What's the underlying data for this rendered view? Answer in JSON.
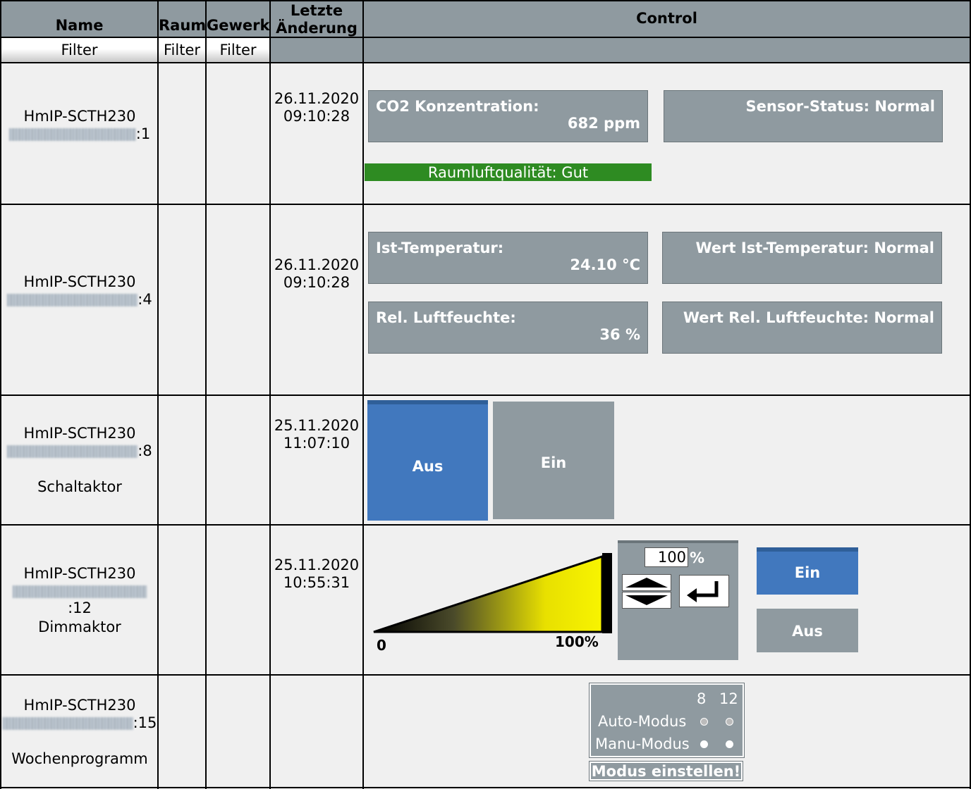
{
  "header": {
    "name": "Name",
    "raum": "Raum",
    "gewerk": "Gewerk",
    "letzte_line1": "Letzte",
    "letzte_line2": "Änderung",
    "control": "Control"
  },
  "filters": {
    "name": "Filter",
    "raum": "Filter",
    "gewerk": "Filter"
  },
  "rows": [
    {
      "device": "HmIP-SCTH230",
      "channel_suffix": ":1",
      "date": "26.11.2020",
      "time": "09:10:28",
      "co2_label": "CO2 Konzentration:",
      "co2_value": "682 ppm",
      "sensor_status": "Sensor-Status: Normal",
      "air_quality": "Raumluftqualität: Gut"
    },
    {
      "device": "HmIP-SCTH230",
      "channel_suffix": ":4",
      "date": "26.11.2020",
      "time": "09:10:28",
      "temp_label": "Ist-Temperatur:",
      "temp_value": "24.10 °C",
      "temp_status": "Wert Ist-Temperatur: Normal",
      "hum_label": "Rel. Luftfeuchte:",
      "hum_value": "36 %",
      "hum_status": "Wert Rel. Luftfeuchte: Normal"
    },
    {
      "device": "HmIP-SCTH230",
      "channel_suffix": ":8",
      "type": "Schaltaktor",
      "date": "25.11.2020",
      "time": "11:07:10",
      "off_label": "Aus",
      "on_label": "Ein",
      "state": "Aus"
    },
    {
      "device": "HmIP-SCTH230",
      "channel_suffix": ":12",
      "type": "Dimmaktor",
      "date": "25.11.2020",
      "time": "10:55:31",
      "scale_min": "0",
      "scale_max": "100%",
      "level_input": "100",
      "level_unit": "%",
      "level": 1.0,
      "on_label": "Ein",
      "off_label": "Aus"
    },
    {
      "device": "HmIP-SCTH230",
      "channel_suffix": ":15",
      "type": "Wochenprogramm",
      "col1": "8",
      "col2": "12",
      "auto_label": "Auto-Modus",
      "manu_label": "Manu-Modus",
      "set_button": "Modus einstellen!"
    }
  ],
  "colors": {
    "header_bg": "#8f9aa0",
    "cell_bg": "#f0f0f0",
    "active_blue": "#4178be",
    "inactive_gray": "#8f9aa0",
    "air_good_green": "#2e8b22",
    "dimmer_yellow": "#f4f000"
  },
  "icons": {
    "increase": "triangle-up-icon",
    "decrease": "triangle-down-icon",
    "enter": "enter-arrow-icon"
  }
}
